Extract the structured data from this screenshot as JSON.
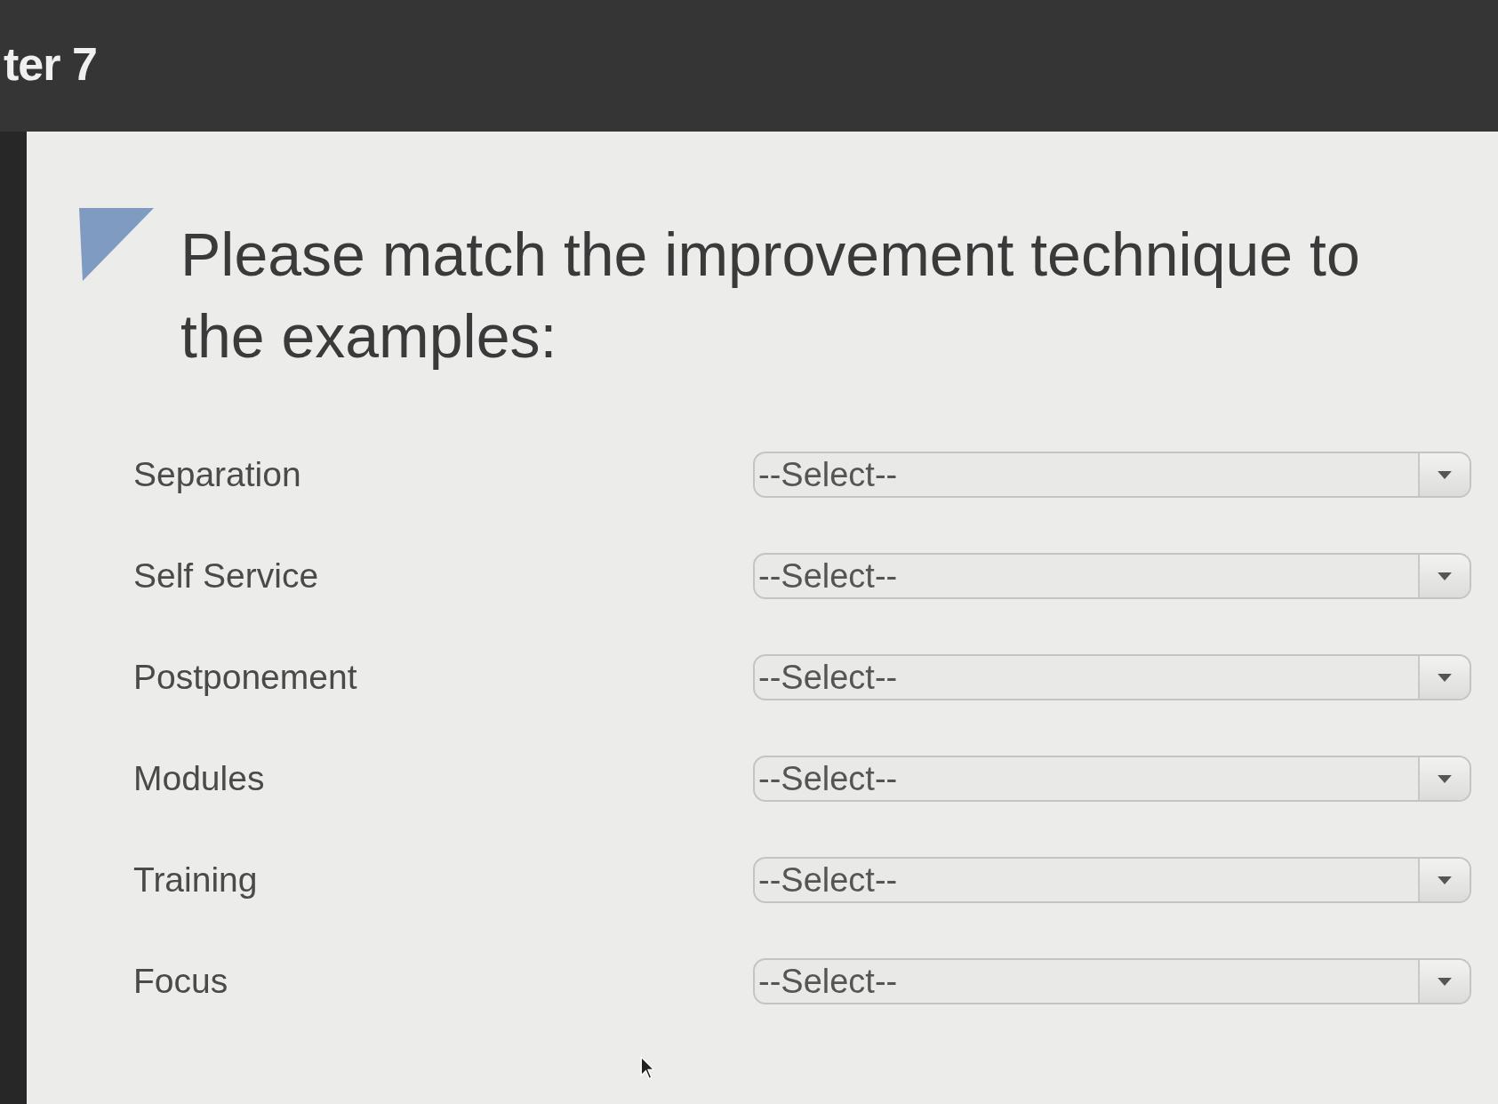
{
  "header": {
    "title": "ter 7"
  },
  "question": {
    "text": "Please match the improvement technique to the examples:"
  },
  "items": [
    {
      "label": "Separation",
      "select": {
        "value": "--Select--"
      }
    },
    {
      "label": "Self Service",
      "select": {
        "value": "--Select--"
      }
    },
    {
      "label": "Postponement",
      "select": {
        "value": "--Select--"
      }
    },
    {
      "label": "Modules",
      "select": {
        "value": "--Select--"
      }
    },
    {
      "label": "Training",
      "select": {
        "value": "--Select--"
      }
    },
    {
      "label": "Focus",
      "select": {
        "value": "--Select--"
      }
    }
  ]
}
